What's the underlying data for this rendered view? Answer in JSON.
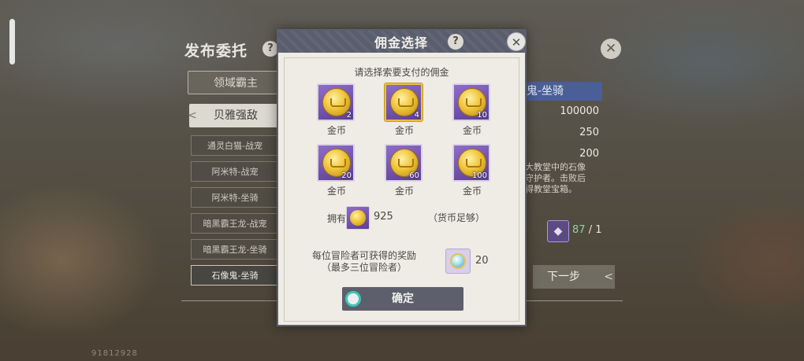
{
  "background": {
    "id_text": "91812928"
  },
  "back_panel": {
    "title": "发布委托",
    "help_icon": "?",
    "close_icon": "✕",
    "tabs": [
      {
        "label": "领域霸主"
      },
      {
        "label": "贝雅强敌"
      }
    ],
    "list_items": [
      {
        "label": "通灵白猫-战宠"
      },
      {
        "label": "阿米特-战宠"
      },
      {
        "label": "阿米特-坐骑"
      },
      {
        "label": "暗黑霸王龙-战宠"
      },
      {
        "label": "暗黑霸王龙-坐骑"
      },
      {
        "label": "石像鬼-坐骑"
      }
    ],
    "selected_header": "鬼-坐骑",
    "stats": [
      "100000",
      "250",
      "200"
    ],
    "description": "大教堂中的石像\n守护者。击败后\n得教堂宝箱。",
    "relic": {
      "have": "87",
      "total": "/ 1"
    },
    "next_button": "下一步"
  },
  "modal": {
    "title": "佣金选择",
    "help_icon": "?",
    "close_icon": "✕",
    "prompt": "请选择索要支付的佣金",
    "options": [
      {
        "label": "金币",
        "qty": "2"
      },
      {
        "label": "金币",
        "qty": "4"
      },
      {
        "label": "金币",
        "qty": "10"
      },
      {
        "label": "金币",
        "qty": "20"
      },
      {
        "label": "金币",
        "qty": "60"
      },
      {
        "label": "金币",
        "qty": "100"
      }
    ],
    "selected_option_index": 1,
    "own_label": "拥有",
    "own_value": "925",
    "own_status": "（货币足够）",
    "reward_label": "每位冒险者可获得的奖励\n（最多三位冒险者）",
    "reward_value": "20",
    "confirm_label": "确定"
  },
  "colors": {
    "modal_header": "#5a5d6d",
    "modal_body": "#efece5",
    "coin_tile": "#7a55b4",
    "selected_border": "#e8c23c",
    "confirm_ring": "#3fc6b6",
    "selected_header_bg": "#4a5f98"
  },
  "icons": {
    "help": "question-circle-icon",
    "close": "close-icon",
    "coin": "gold-coin-icon",
    "reward": "crystal-medal-icon",
    "relic": "relic-icon"
  }
}
